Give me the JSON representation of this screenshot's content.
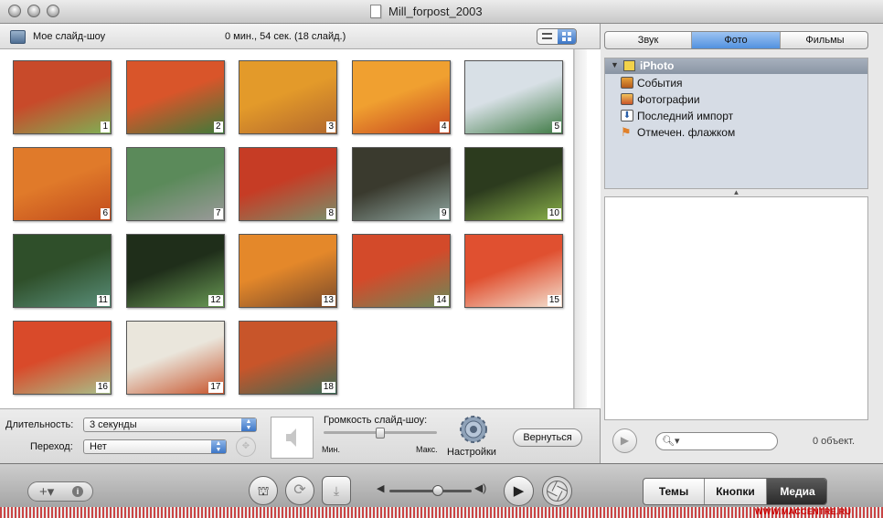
{
  "window": {
    "title": "Mill_forpost_2003"
  },
  "header": {
    "slideshow_name": "Мое слайд-шоу",
    "slideshow_info": "0 мин., 54 сек. (18 слайд.)"
  },
  "slides": [
    {
      "n": "1",
      "c1": "#c84a2a",
      "c2": "#7fb055"
    },
    {
      "n": "2",
      "c1": "#d9552a",
      "c2": "#3f7a3a"
    },
    {
      "n": "3",
      "c1": "#e39a2a",
      "c2": "#b3682c"
    },
    {
      "n": "4",
      "c1": "#f0a030",
      "c2": "#c6451f"
    },
    {
      "n": "5",
      "c1": "#d8e0e6",
      "c2": "#3f7a45"
    },
    {
      "n": "6",
      "c1": "#e07a2a",
      "c2": "#c24b1c"
    },
    {
      "n": "7",
      "c1": "#5b8a5a",
      "c2": "#9a9a9a"
    },
    {
      "n": "8",
      "c1": "#c63c25",
      "c2": "#7a8f6a"
    },
    {
      "n": "9",
      "c1": "#3a3a2e",
      "c2": "#8fa6a0"
    },
    {
      "n": "10",
      "c1": "#2c3b1e",
      "c2": "#89b04a"
    },
    {
      "n": "11",
      "c1": "#2f4f2a",
      "c2": "#5a8f7a"
    },
    {
      "n": "12",
      "c1": "#1f2e1a",
      "c2": "#6a9a55"
    },
    {
      "n": "13",
      "c1": "#e4882a",
      "c2": "#7a4a2a"
    },
    {
      "n": "14",
      "c1": "#d34a2a",
      "c2": "#6b8a5a"
    },
    {
      "n": "15",
      "c1": "#e05030",
      "c2": "#f3e0d0"
    },
    {
      "n": "16",
      "c1": "#d94a2a",
      "c2": "#a8c08a"
    },
    {
      "n": "17",
      "c1": "#eae6dc",
      "c2": "#c7542c"
    },
    {
      "n": "18",
      "c1": "#c8552a",
      "c2": "#3a6a55"
    }
  ],
  "settings": {
    "duration_label": "Длительность:",
    "duration_value": "3 секунды",
    "transition_label": "Переход:",
    "transition_value": "Нет",
    "volume_label": "Громкость слайд-шоу:",
    "vol_min": "Мин.",
    "vol_max": "Макс.",
    "settings_label": "Настройки",
    "return_label": "Вернуться"
  },
  "media": {
    "tabs": [
      "Звук",
      "Фото",
      "Фильмы"
    ],
    "active_tab": "Фото",
    "source_header": "iPhoto",
    "sources": [
      "События",
      "Фотографии",
      "Последний импорт",
      "Отмечен. флажком"
    ],
    "object_count": "0 объект."
  },
  "toolbar": {
    "segments": [
      "Темы",
      "Кнопки",
      "Медиа"
    ],
    "active_segment": "Медиа",
    "watermark_url": "WWW.MACCENTRE.RU"
  }
}
